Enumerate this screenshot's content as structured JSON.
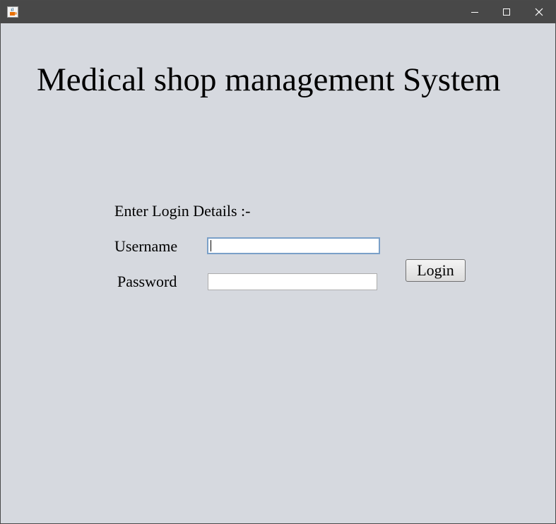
{
  "window": {
    "icon": "java-coffee-icon",
    "controls": [
      "minimize-icon",
      "maximize-icon",
      "close-icon"
    ]
  },
  "main": {
    "heading": "Medical shop management System",
    "login_prompt": "Enter Login Details :-",
    "username_label": "Username",
    "username_value": "",
    "password_label": "Password",
    "password_value": "",
    "login_button": "Login"
  },
  "colors": {
    "background": "#d6d9df",
    "titlebar": "#484848",
    "focus_border": "#7aa0c8"
  }
}
